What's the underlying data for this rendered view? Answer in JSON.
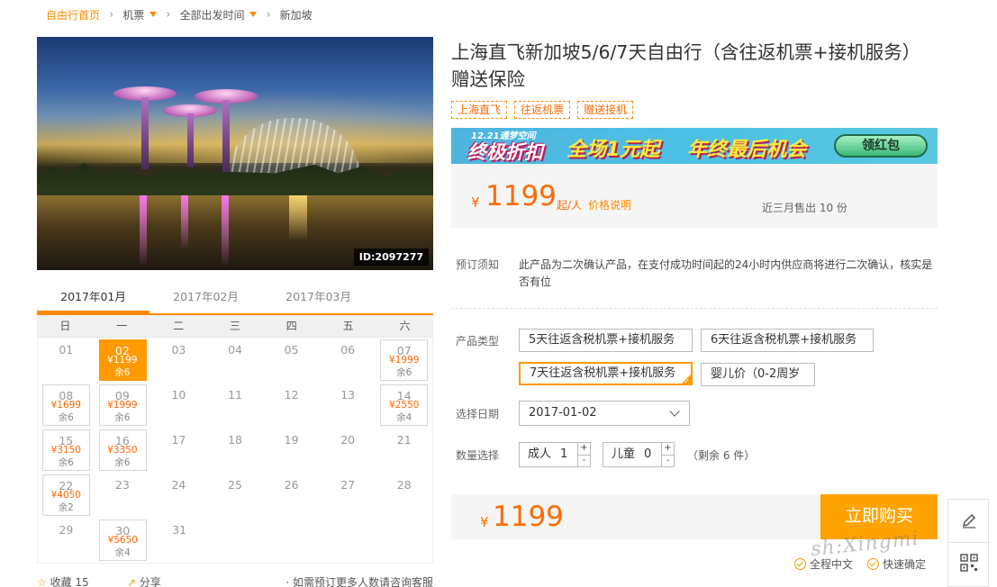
{
  "breadcrumb": {
    "home": "自由行首页",
    "category": "机票",
    "departure": "全部出发时间",
    "destination": "新加坡"
  },
  "hero": {
    "image_id": "ID:2097277"
  },
  "calendar": {
    "months": [
      "2017年01月",
      "2017年02月",
      "2017年03月"
    ],
    "active_month": 0,
    "weekdays": [
      "日",
      "一",
      "二",
      "三",
      "四",
      "五",
      "六"
    ],
    "weeks": [
      [
        {
          "day": "01"
        },
        {
          "day": "02",
          "price": "¥1199",
          "remain": "余6",
          "selected": true
        },
        {
          "day": "03"
        },
        {
          "day": "04"
        },
        {
          "day": "05"
        },
        {
          "day": "06"
        },
        {
          "day": "07",
          "price": "¥1999",
          "remain": "余6"
        }
      ],
      [
        {
          "day": "08",
          "price": "¥1699",
          "remain": "余6"
        },
        {
          "day": "09",
          "price": "¥1999",
          "remain": "余6"
        },
        {
          "day": "10"
        },
        {
          "day": "11"
        },
        {
          "day": "12"
        },
        {
          "day": "13"
        },
        {
          "day": "14",
          "price": "¥2550",
          "remain": "余4"
        }
      ],
      [
        {
          "day": "15",
          "price": "¥3150",
          "remain": "余6"
        },
        {
          "day": "16",
          "price": "¥3350",
          "remain": "余6"
        },
        {
          "day": "17"
        },
        {
          "day": "18"
        },
        {
          "day": "19"
        },
        {
          "day": "20"
        },
        {
          "day": "21"
        }
      ],
      [
        {
          "day": "22",
          "price": "¥4050",
          "remain": "余2"
        },
        {
          "day": "23"
        },
        {
          "day": "24"
        },
        {
          "day": "25"
        },
        {
          "day": "26"
        },
        {
          "day": "27"
        },
        {
          "day": "28"
        }
      ],
      [
        {
          "day": "29"
        },
        {
          "day": "30",
          "price": "¥5650",
          "remain": "余4"
        },
        {
          "day": "31"
        }
      ]
    ]
  },
  "left_footer": {
    "favorite": "收藏 15",
    "share": "分享",
    "note": "· 如需预订更多人数请咨询客服"
  },
  "product": {
    "title": "上海直飞新加坡5/6/7天自由行（含往返机票+接机服务）赠送保险",
    "tags": [
      "上海直飞",
      "往返机票",
      "赠送接机"
    ],
    "banner": {
      "date": "12.21通梦空间",
      "headline": "终极折扣",
      "slogan1": "全场1元起",
      "slogan2": "年终最后机会",
      "button": "领红包"
    },
    "price": {
      "currency": "¥",
      "amount": "1199",
      "unit": "起/人",
      "explain": "价格说明",
      "sold": "近三月售出 10 份"
    },
    "notice": {
      "label": "预订须知",
      "text": "此产品为二次确认产品，在支付成功时间起的24小时内供应商将进行二次确认，核实是否有位"
    },
    "type": {
      "label": "产品类型",
      "options": [
        "5天往返含税机票+接机服务",
        "6天往返含税机票+接机服务",
        "7天往返含税机票+接机服务",
        "婴儿价（0-2周岁"
      ],
      "selected": 2
    },
    "date": {
      "label": "选择日期",
      "value": "2017-01-02"
    },
    "quantity": {
      "label": "数量选择",
      "adult_label": "成人",
      "adult_value": "1",
      "child_label": "儿童",
      "child_value": "0",
      "plus": "+",
      "minus": "-",
      "remain": "（剩余 6 件）"
    },
    "total": {
      "currency": "¥",
      "amount": "1199"
    },
    "buy_button": "立即购买",
    "guarantees": [
      "全程中文",
      "快速确定"
    ]
  },
  "watermark": "sh:Xingmi"
}
